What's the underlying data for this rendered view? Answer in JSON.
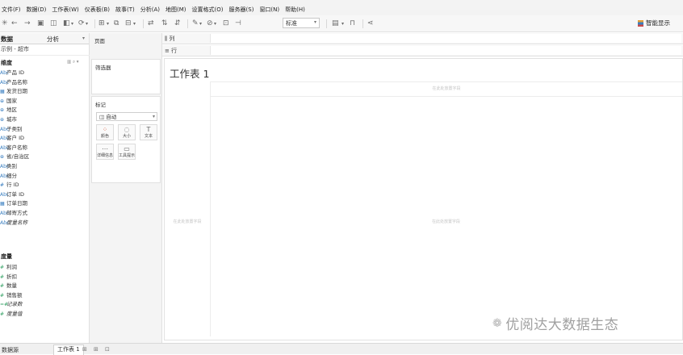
{
  "menu": [
    "文件(F)",
    "数据(D)",
    "工作表(W)",
    "仪表板(B)",
    "故事(T)",
    "分析(A)",
    "地图(M)",
    "设置格式(O)",
    "服务器(S)",
    "窗口(N)",
    "帮助(H)"
  ],
  "toolbar": {
    "format_select": "标准",
    "show_me": "智能显示"
  },
  "data_pane": {
    "tab_data": "数据",
    "tab_analytics": "分析",
    "tab_arrow": "▾",
    "source": "示例 - 超市",
    "dimensions_header": "维度",
    "dimension_tools": "▥ ⌕ ▾",
    "dimensions": [
      {
        "type": "Abc",
        "name": "产品 ID"
      },
      {
        "type": "Abc",
        "name": "产品名称"
      },
      {
        "type": "▦",
        "name": "发货日期"
      },
      {
        "type": "⊕",
        "name": "国家"
      },
      {
        "type": "⊕",
        "name": "地区"
      },
      {
        "type": "⊕",
        "name": "城市"
      },
      {
        "type": "Abc",
        "name": "子类别"
      },
      {
        "type": "Abc",
        "name": "客户 ID"
      },
      {
        "type": "Abc",
        "name": "客户名称"
      },
      {
        "type": "⊕",
        "name": "省/自治区"
      },
      {
        "type": "Abc",
        "name": "类别"
      },
      {
        "type": "Abc",
        "name": "细分"
      },
      {
        "type": "#",
        "name": "行 ID"
      },
      {
        "type": "Abc",
        "name": "订单 ID"
      },
      {
        "type": "▦",
        "name": "订单日期"
      },
      {
        "type": "Abc",
        "name": "邮寄方式"
      },
      {
        "type": "Abc",
        "name": "度量名称",
        "italic": true
      }
    ],
    "measures_header": "度量",
    "measures": [
      {
        "type": "#",
        "name": "利润"
      },
      {
        "type": "#",
        "name": "折扣"
      },
      {
        "type": "#",
        "name": "数量"
      },
      {
        "type": "#",
        "name": "销售额"
      },
      {
        "type": "=#",
        "name": "记录数",
        "italic": true
      },
      {
        "type": "#",
        "name": "度量值",
        "italic": true
      }
    ]
  },
  "cards": {
    "pages": "页面",
    "filters": "筛选器",
    "marks": "标记",
    "mark_type": "◫ 自动",
    "mark_buttons": [
      {
        "glyph": "⁘",
        "label": "颜色"
      },
      {
        "glyph": "◌",
        "label": "大小"
      },
      {
        "glyph": "T",
        "label": "文本"
      },
      {
        "glyph": "⋯",
        "label": "详细信息"
      },
      {
        "glyph": "▭",
        "label": "工具提示"
      }
    ]
  },
  "shelves": {
    "columns": "⫼ 列",
    "rows": "≡ 行"
  },
  "worksheet": {
    "title": "工作表 1",
    "drop_field_hint": "在此处放置字段"
  },
  "watermark": "优阅达大数据生态",
  "tabs": {
    "datasource": "数据源",
    "sheet1": "工作表 1",
    "new_sheet": "⊞",
    "new_dashboard": "⊞",
    "new_story": "⊡"
  },
  "colors": {
    "dimension": "#3a7fc1",
    "measure": "#3aa56a"
  }
}
